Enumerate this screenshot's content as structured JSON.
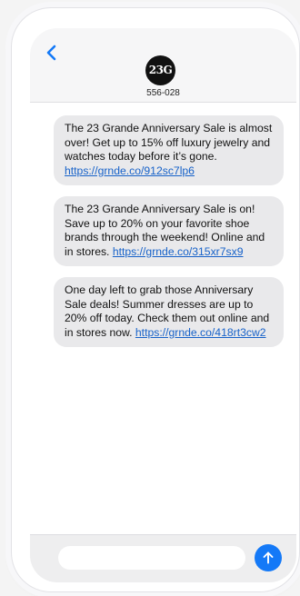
{
  "contact": {
    "avatar_text": "23G",
    "number": "556-028"
  },
  "messages": [
    {
      "text": "The 23 Grande Anniversary Sale is almost over! Get up to 15% off luxury jewelry and watches today before it’s gone. ",
      "link": "https://grnde.co/912sc7lp6"
    },
    {
      "text": "The 23 Grande Anniversary Sale is on! Save up to 20% on your favorite shoe brands through the weekend! Online and in stores. ",
      "link": "https://grnde.co/315xr7sx9"
    },
    {
      "text": "One day left to grab those Anniversary Sale deals! Summer dresses are up to 20% off today. Check them out online and in stores now. ",
      "link": "https://grnde.co/418rt3cw2"
    }
  ],
  "composer": {
    "placeholder": ""
  },
  "colors": {
    "accent": "#1479f7",
    "bubble": "#e9e9eb",
    "link": "#1762c9"
  },
  "icons": {
    "back": "chevron-left-icon",
    "send": "arrow-up-icon"
  }
}
